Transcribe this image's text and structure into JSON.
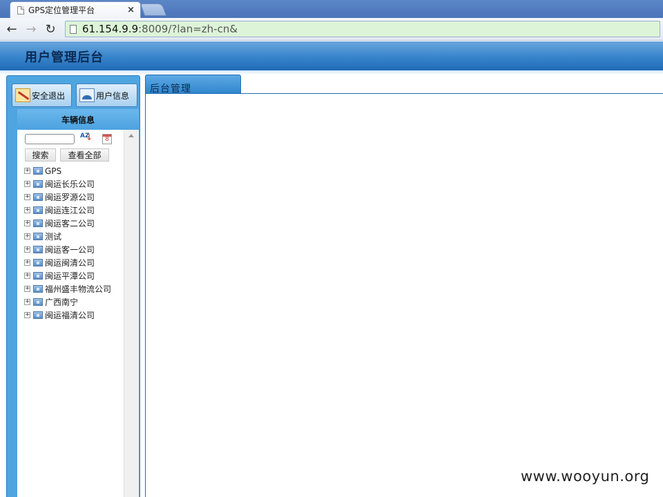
{
  "browser": {
    "tab_title": "GPS定位管理平台",
    "tab_close": "×",
    "url_host": "61.154.9.9",
    "url_rest": ":8009/?lan=zh-cn&",
    "back": "←",
    "forward": "→",
    "reload": "↻"
  },
  "header": {
    "title": "用户管理后台"
  },
  "left": {
    "logout_label": "安全退出",
    "userinfo_label": "用户信息",
    "vehicle_title": "车辆信息",
    "search_button": "搜索",
    "view_all_button": "查看全部",
    "sort_az": "AZ",
    "sort_date": "8",
    "tree": [
      "GPS",
      "闽运长乐公司",
      "闽运罗源公司",
      "闽运连江公司",
      "闽运客二公司",
      "测试",
      "闽运客一公司",
      "闽运闽清公司",
      "闽运平潭公司",
      "福州盛丰物流公司",
      "广西南宁",
      "闽运福清公司"
    ]
  },
  "main": {
    "tab_label": "后台管理"
  },
  "watermark": "www.wooyun.org"
}
